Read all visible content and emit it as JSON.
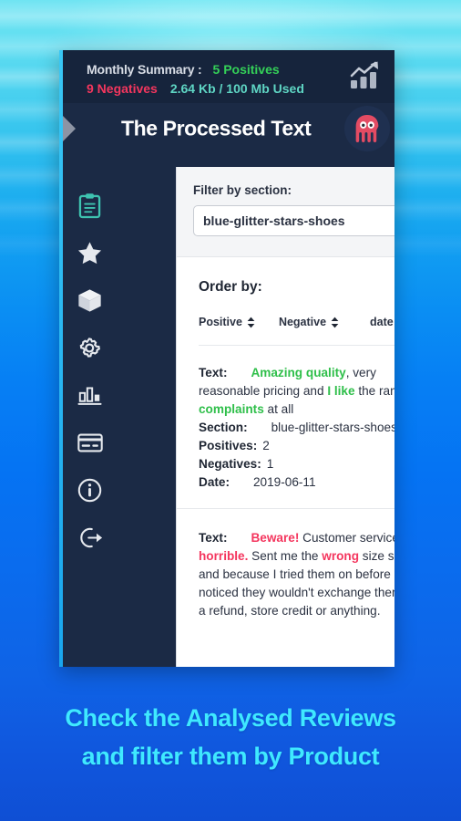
{
  "summary": {
    "label": "Monthly Summary :",
    "positives": "5 Positives",
    "negatives": "9 Negatives",
    "data_used": "2.64 Kb / 100 Mb Used",
    "growth_icon": "growth-chart-icon",
    "colors": {
      "positive": "#34d058",
      "negative": "#f4365e",
      "data": "#5fd6c4",
      "label": "#d8dde6"
    }
  },
  "titlebar": {
    "title": "The Processed Text",
    "toggle_icon": "chevron-right-icon",
    "mascot_icon": "octopus-mascot-icon"
  },
  "sidebar": {
    "items": [
      {
        "icon": "clipboard-icon",
        "name": "sidebar-item-reviews",
        "active": true
      },
      {
        "icon": "star-icon",
        "name": "sidebar-item-favourites",
        "active": false
      },
      {
        "icon": "box-icon",
        "name": "sidebar-item-products",
        "active": false
      },
      {
        "icon": "gear-icon",
        "name": "sidebar-item-settings",
        "active": false
      },
      {
        "icon": "bar-chart-icon",
        "name": "sidebar-item-statistics",
        "active": false
      },
      {
        "icon": "credit-card-icon",
        "name": "sidebar-item-billing",
        "active": false
      },
      {
        "icon": "info-icon",
        "name": "sidebar-item-info",
        "active": false
      },
      {
        "icon": "logout-icon",
        "name": "sidebar-item-logout",
        "active": false
      }
    ],
    "active_color": "#3ec3b0"
  },
  "filter": {
    "label": "Filter by section:",
    "value": "blue-glitter-stars-shoes",
    "placeholder": "Filter by section"
  },
  "order": {
    "title": "Order by:",
    "options": [
      {
        "label": "Positive",
        "sort_icon": "sort-updown-icon",
        "highlight": false
      },
      {
        "label": "Negative",
        "sort_icon": "sort-updown-icon",
        "highlight": false
      },
      {
        "label": "date",
        "sort_icon": "sort-updown-icon",
        "highlight": true
      }
    ],
    "highlight_color": "#3ec3b0"
  },
  "reviews": [
    {
      "text_key": "Text:",
      "segments": [
        {
          "t": "Amazing quality",
          "type": "positive"
        },
        {
          "t": ", very reasonable pricing and ",
          "type": "plain"
        },
        {
          "t": "I like",
          "type": "positive"
        },
        {
          "t": " the range ",
          "type": "plain"
        },
        {
          "t": "no complaints",
          "type": "positive"
        },
        {
          "t": " at all",
          "type": "plain"
        }
      ],
      "section_key": "Section:",
      "section_value": "blue-glitter-stars-shoes",
      "positives_key": "Positives:",
      "positives_value": "2",
      "negatives_key": "Negatives:",
      "negatives_value": "1",
      "date_key": "Date:",
      "date_value": "2019-06-11"
    },
    {
      "text_key": "Text:",
      "segments": [
        {
          "t": "Beware!",
          "type": "negative"
        },
        {
          "t": " Customer service is ",
          "type": "plain"
        },
        {
          "t": "horrible.",
          "type": "negative"
        },
        {
          "t": " Sent me the ",
          "type": "plain"
        },
        {
          "t": "wrong",
          "type": "negative"
        },
        {
          "t": " size shoes and because I tried them on before I noticed they wouldn't exchange them, do a refund, store credit or anything.",
          "type": "plain"
        }
      ]
    }
  ],
  "caption": {
    "line1": "Check the Analysed Reviews",
    "line2": "and filter them by Product",
    "color": "#3fe9ff"
  }
}
